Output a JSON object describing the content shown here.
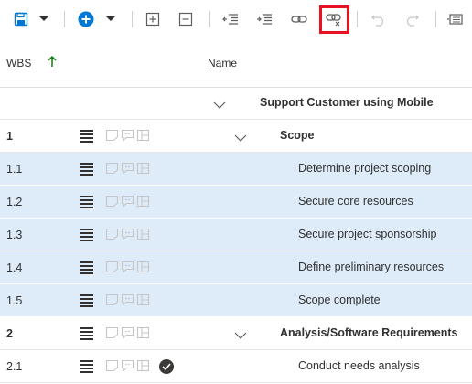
{
  "toolbar": {
    "buttons": [
      "save-icon",
      "dropdown-icon",
      "add-task-icon",
      "dropdown-icon",
      "expand-icon",
      "collapse-icon",
      "outdent-icon",
      "indent-icon",
      "link-tasks-icon",
      "unlink-tasks-icon",
      "undo-icon",
      "redo-icon",
      "grid-options-icon"
    ],
    "highlight": "unlink-tasks-icon"
  },
  "columns": {
    "wbs": "WBS",
    "name": "Name"
  },
  "rows": [
    {
      "wbs": "",
      "name": "Support Customer using Mobile",
      "bold": true,
      "level": 0,
      "expander": true,
      "selected": false,
      "completed": false
    },
    {
      "wbs": "1",
      "name": "Scope",
      "bold": true,
      "level": 1,
      "expander": true,
      "selected": false,
      "completed": false
    },
    {
      "wbs": "1.1",
      "name": "Determine project scoping",
      "bold": false,
      "level": 2,
      "expander": false,
      "selected": true,
      "completed": false
    },
    {
      "wbs": "1.2",
      "name": "Secure core resources",
      "bold": false,
      "level": 2,
      "expander": false,
      "selected": true,
      "completed": false
    },
    {
      "wbs": "1.3",
      "name": "Secure project sponsorship",
      "bold": false,
      "level": 2,
      "expander": false,
      "selected": true,
      "completed": false
    },
    {
      "wbs": "1.4",
      "name": "Define preliminary resources",
      "bold": false,
      "level": 2,
      "expander": false,
      "selected": true,
      "completed": false
    },
    {
      "wbs": "1.5",
      "name": "Scope complete",
      "bold": false,
      "level": 2,
      "expander": false,
      "selected": true,
      "completed": false
    },
    {
      "wbs": "2",
      "name": "Analysis/Software Requirements",
      "bold": true,
      "level": 1,
      "expander": true,
      "selected": false,
      "completed": false
    },
    {
      "wbs": "2.1",
      "name": "Conduct needs analysis",
      "bold": false,
      "level": 2,
      "expander": false,
      "selected": false,
      "completed": true
    }
  ],
  "colors": {
    "accent": "#0078d4",
    "selected_row": "#deecf9",
    "highlight": "#e81123",
    "sort_arrow": "#107c10"
  }
}
